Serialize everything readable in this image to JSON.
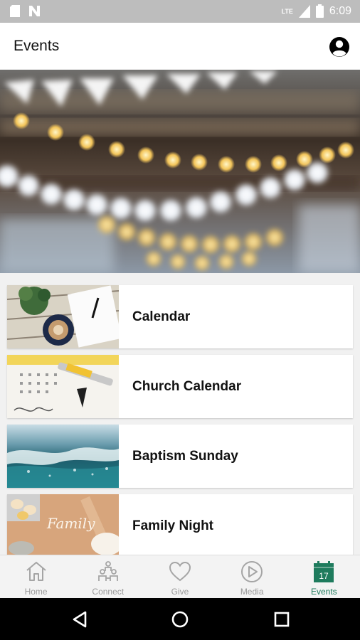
{
  "status_bar": {
    "time": "6:09",
    "network": "LTE",
    "icons": [
      "sd-card-icon",
      "n-notification-icon",
      "signal-icon",
      "battery-icon"
    ]
  },
  "app_bar": {
    "title": "Events",
    "profile_icon": "account-circle-icon"
  },
  "events": [
    {
      "label": "Calendar",
      "image": "desk-notebook-coffee-photo"
    },
    {
      "label": "Church Calendar",
      "image": "paper-calendar-marker-photo"
    },
    {
      "label": "Baptism Sunday",
      "image": "ocean-wave-photo"
    },
    {
      "label": "Family Night",
      "image": "family-flour-eggs-photo"
    }
  ],
  "bottom_nav": {
    "items": [
      {
        "label": "Home",
        "icon": "home-icon",
        "active": false
      },
      {
        "label": "Connect",
        "icon": "people-icon",
        "active": false
      },
      {
        "label": "Give",
        "icon": "heart-icon",
        "active": false
      },
      {
        "label": "Media",
        "icon": "play-circle-icon",
        "active": false
      },
      {
        "label": "Events",
        "icon": "calendar-17-icon",
        "active": true
      }
    ],
    "calendar_day": "17",
    "active_color": "#1e7b5d",
    "inactive_color": "#9a9a9a"
  },
  "system_nav": {
    "buttons": [
      "back-icon",
      "home-circle-icon",
      "recents-icon"
    ]
  }
}
